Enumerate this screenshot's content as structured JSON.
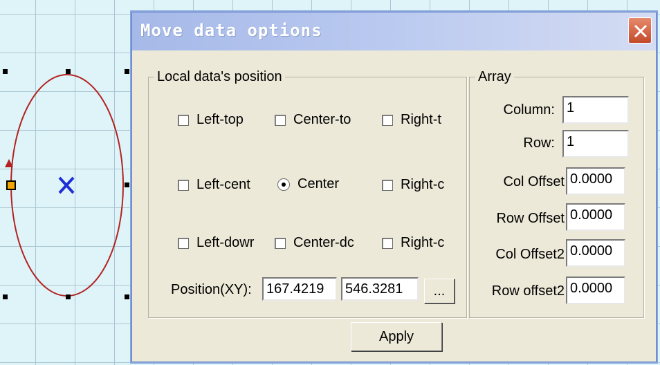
{
  "dialog": {
    "title": "Move data options",
    "local_group": {
      "legend": "Local data's position",
      "options": [
        {
          "label": "Left-top",
          "type": "checkbox"
        },
        {
          "label": "Center-to",
          "type": "checkbox"
        },
        {
          "label": "Right-t",
          "type": "checkbox"
        },
        {
          "label": "Left-cent",
          "type": "checkbox"
        },
        {
          "label": "Center",
          "type": "radio",
          "selected": true
        },
        {
          "label": "Right-c",
          "type": "checkbox"
        },
        {
          "label": "Left-dowr",
          "type": "checkbox"
        },
        {
          "label": "Center-dc",
          "type": "checkbox"
        },
        {
          "label": "Right-c",
          "type": "checkbox"
        }
      ],
      "position_label": "Position(XY):",
      "position_x": "167.4219",
      "position_y": "546.3281",
      "browse_label": "..."
    },
    "array_group": {
      "legend": "Array",
      "fields": [
        {
          "label": "Column:",
          "value": "1"
        },
        {
          "label": "Row:",
          "value": "1"
        },
        {
          "label": "Col Offset",
          "value": "0.0000"
        },
        {
          "label": "Row Offset",
          "value": "0.0000"
        },
        {
          "label": "Col Offset2",
          "value": "0.0000"
        },
        {
          "label": "Row offset2",
          "value": "0.0000"
        }
      ]
    },
    "apply_label": "Apply"
  },
  "colors": {
    "canvas_bg": "#dff4f8",
    "grid": "#a9c6d2",
    "ellipse": "#b22222",
    "center_mark": "#1f2fd6",
    "anchor_handle": "#f0a800",
    "dialog_bg": "#ece9d8",
    "titlebar": "#a6b9e8",
    "close_button": "#c44a2a"
  }
}
